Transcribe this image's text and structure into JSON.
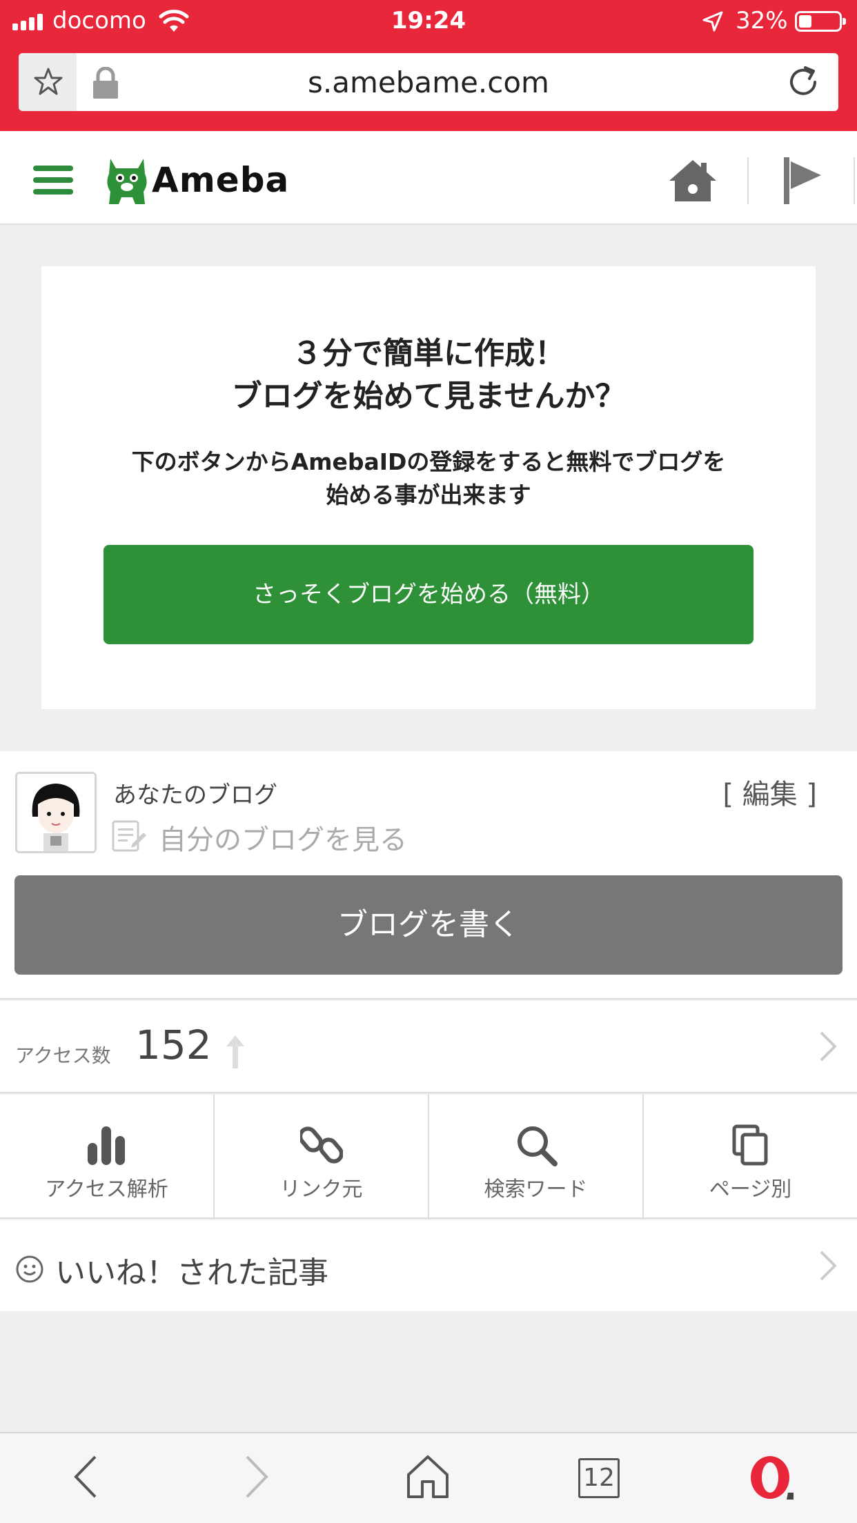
{
  "status": {
    "carrier": "docomo",
    "time": "19:24",
    "battery_pct": "32%",
    "battery_level": 0.32
  },
  "browser": {
    "url": "s.amebame.com",
    "tabs_count": "12"
  },
  "header": {
    "logo_text": "Ameba"
  },
  "promo": {
    "headline_line1": "３分で簡単に作成！",
    "headline_line2": "ブログを始めて見ませんか？",
    "desc_line1": "下のボタンからAmebaIDの登録をすると無料でブログを",
    "desc_line2": "始める事が出来ます",
    "cta": "さっそくブログを始める（無料）"
  },
  "blog": {
    "your_blog": "あなたのブログ",
    "edit": "[ 編集 ]",
    "view_own": "自分のブログを見る",
    "write": "ブログを書く"
  },
  "access": {
    "label": "アクセス数",
    "count": "152"
  },
  "stats_menu": [
    {
      "label": "アクセス解析",
      "icon": "bar-chart-icon"
    },
    {
      "label": "リンク元",
      "icon": "link-icon"
    },
    {
      "label": "検索ワード",
      "icon": "search-icon"
    },
    {
      "label": "ページ別",
      "icon": "pages-icon"
    }
  ],
  "liked": {
    "label": "いいね！された記事"
  },
  "colors": {
    "browser_red": "#e9273a",
    "ameba_green": "#2e9138",
    "write_gray": "#777777"
  }
}
